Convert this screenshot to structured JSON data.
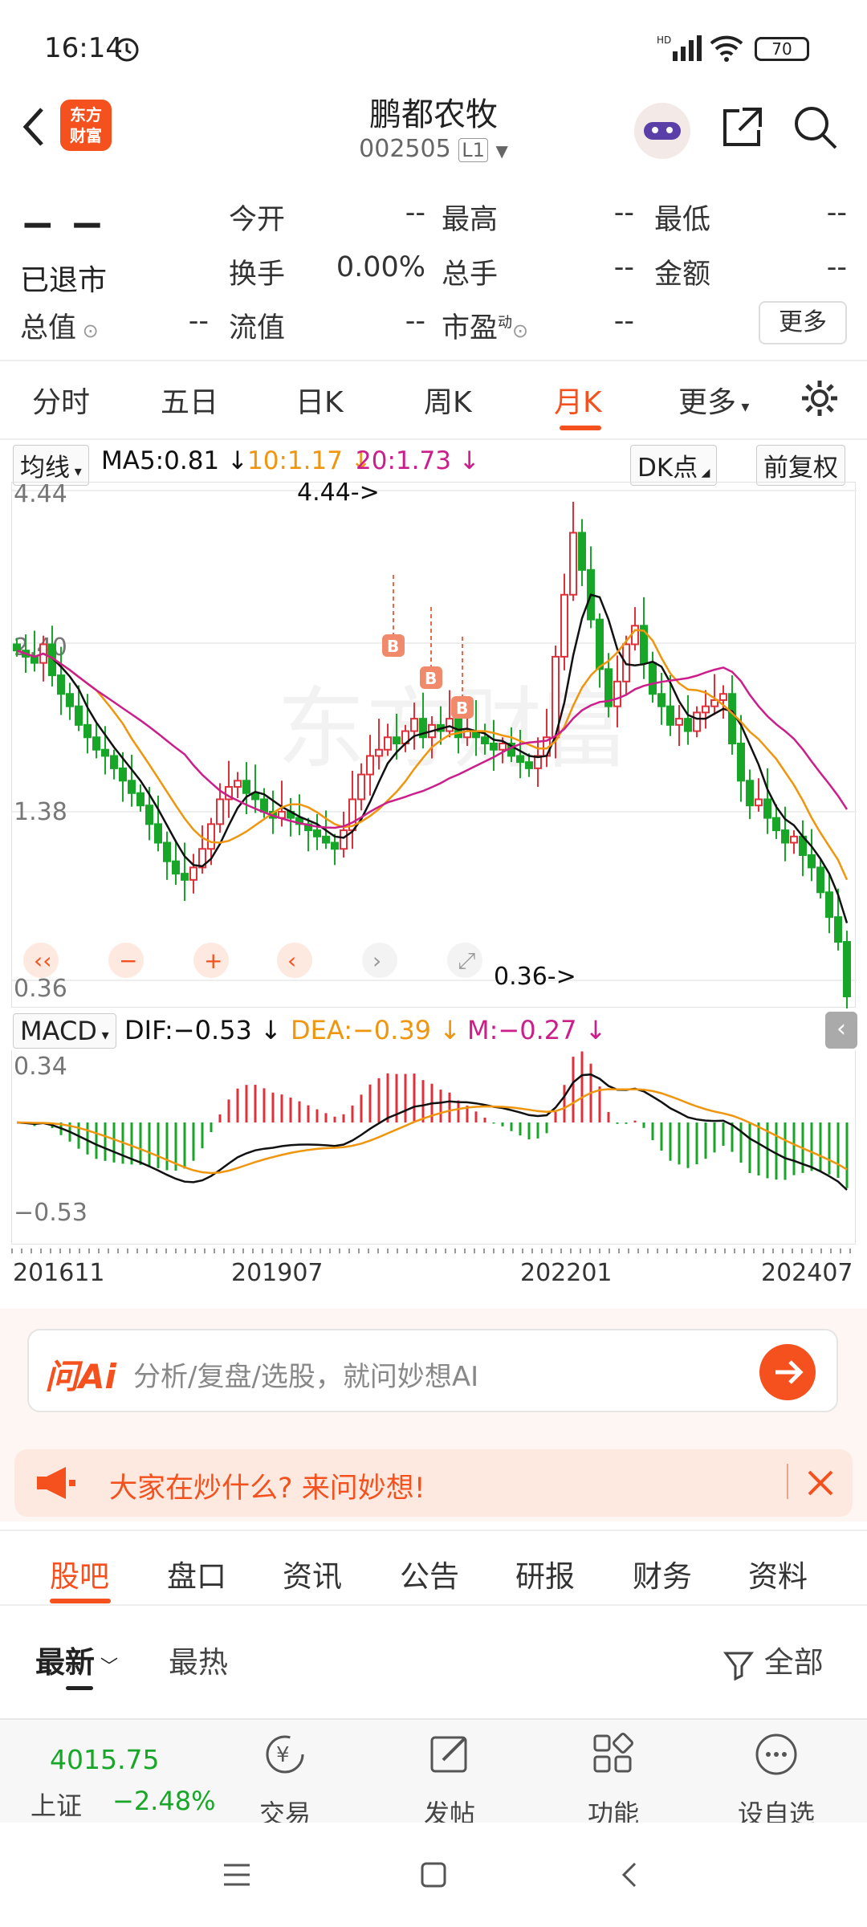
{
  "status": {
    "time": "16:14",
    "battery": "70"
  },
  "header": {
    "logo": "东方财富",
    "name": "鹏都农牧",
    "code": "002505",
    "level": "L1"
  },
  "quote": {
    "price": "− −",
    "status": "已退市",
    "rows": [
      [
        {
          "label": "今开",
          "value": "--"
        },
        {
          "label": "最高",
          "value": "--"
        },
        {
          "label": "最低",
          "value": "--"
        }
      ],
      [
        {
          "label": "换手",
          "value": "0.00%"
        },
        {
          "label": "总手",
          "value": "--"
        },
        {
          "label": "金额",
          "value": "--"
        }
      ],
      [
        {
          "label": "总值",
          "value": "--"
        },
        {
          "label": "流值",
          "value": "--"
        },
        {
          "label": "市盈",
          "value": "--"
        }
      ]
    ],
    "pe_sup": "动",
    "more": "更多"
  },
  "period_tabs": [
    "分时",
    "五日",
    "日K",
    "周K",
    "月K",
    "更多"
  ],
  "active_tab": "月K",
  "ma": {
    "selector": "均线",
    "ma5": "MA5:0.81",
    "ma10": "10:1.17",
    "ma20": "20:1.73",
    "dk": "DK点",
    "fq": "前复权"
  },
  "colors": {
    "up": "#e0313b",
    "down": "#18a629",
    "ma5": "#111111",
    "ma10": "#f0950e",
    "ma20": "#cc1e8a",
    "accent": "#f4511e"
  },
  "kline": {
    "y_labels": [
      "4.44",
      "2.40",
      "1.38",
      "0.36"
    ],
    "high_label": "4.44->",
    "low_label": "0.36->",
    "buy_marker": "B"
  },
  "macd": {
    "selector": "MACD",
    "dif": "DIF:−0.53",
    "dea": "DEA:−0.39",
    "m": "M:−0.27",
    "y_top": "0.34",
    "y_bottom": "−0.53"
  },
  "x_labels": [
    "201611",
    "201907",
    "202201",
    "202407"
  ],
  "ai": {
    "brand": "问Ai",
    "placeholder": "分析/复盘/选股，就问妙想AI"
  },
  "notice": {
    "text": "大家在炒什么? 来问妙想!"
  },
  "section_tabs": [
    "股吧",
    "盘口",
    "资讯",
    "公告",
    "研报",
    "财务",
    "资料"
  ],
  "sort": {
    "latest": "最新",
    "hot": "最热",
    "filter": "全部"
  },
  "index": {
    "value": "4015.75",
    "name": "上证",
    "change": "−2.48%"
  },
  "bottom_nav": [
    "交易",
    "发帖",
    "功能",
    "设自选"
  ]
}
